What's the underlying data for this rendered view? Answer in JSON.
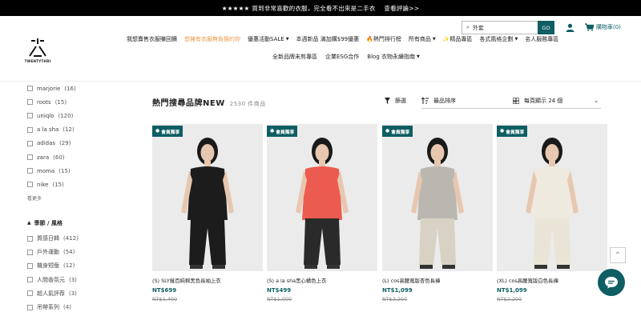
{
  "announcement": {
    "stars": "★★★★★",
    "text": "買到非常喜歡的衣服，完全看不出來是二手衣",
    "link": "查看評論>>"
  },
  "header": {
    "logo_text": "TWENTYTHRI",
    "search": {
      "value": "外套",
      "button": "GO"
    },
    "cart_label": "購物車(0)",
    "nav_row1": [
      {
        "label": "我想賣售衣服賺回饋",
        "chevron": false,
        "highlight": false
      },
      {
        "label": "想擁有衣服無負擔的你",
        "chevron": false,
        "highlight": true
      },
      {
        "label": "優惠活動SALE",
        "chevron": true,
        "highlight": false
      },
      {
        "label": "本週新品 滿加購$99優惠",
        "chevron": false,
        "highlight": false
      },
      {
        "label": "🔥熱門排行榜",
        "chevron": false,
        "highlight": false
      },
      {
        "label": "所有商品",
        "chevron": true,
        "highlight": false
      },
      {
        "label": "✨精品專區",
        "chevron": false,
        "highlight": false
      },
      {
        "label": "各式風格企劃",
        "chevron": true,
        "highlight": false
      },
      {
        "label": "名人服務專區",
        "chevron": false,
        "highlight": false
      }
    ],
    "nav_row2": [
      {
        "label": "全新品牌未剪專區",
        "chevron": false
      },
      {
        "label": "企業ESG合作",
        "chevron": false
      },
      {
        "label": "Blog 衣物永續指南",
        "chevron": true
      }
    ]
  },
  "sidebar": {
    "brands": [
      {
        "name": "marjorie",
        "count": "(16)"
      },
      {
        "name": "roots",
        "count": "(15)"
      },
      {
        "name": "uniqlo",
        "count": "(120)"
      },
      {
        "name": "a la sha",
        "count": "(12)"
      },
      {
        "name": "adidas",
        "count": "(29)"
      },
      {
        "name": "zara",
        "count": "(60)"
      },
      {
        "name": "moma",
        "count": "(15)"
      },
      {
        "name": "nike",
        "count": "(15)"
      }
    ],
    "more_label": "看更多",
    "season_title": "季節 / 風格",
    "seasons": [
      {
        "name": "質感日韓",
        "count": "(412)"
      },
      {
        "name": "戶外運動",
        "count": "(54)"
      },
      {
        "name": "機身短版",
        "count": "(12)"
      },
      {
        "name": "人間香氛元",
        "count": "(3)"
      },
      {
        "name": "超人氣評荐",
        "count": "(3)"
      },
      {
        "name": "吊帶系列",
        "count": "(4)"
      }
    ]
  },
  "main": {
    "title": "熱門搜尋品牌NEW",
    "count": "2530 件商品",
    "filter_label": "篩選",
    "sort_label": "最品排序",
    "per_page_label": "每頁顯示 24 個",
    "products": [
      {
        "badge": "會員獨享",
        "title": "(S) SLY幾百純棉黑色長袖上衣",
        "price": "NT$699",
        "orig_price": "NT$1,400",
        "top_color": "#1c1c1c",
        "bottom_color": "#1c1c1c"
      },
      {
        "badge": "會員獨享",
        "title": "(S) a la sha黑心橘色上衣",
        "price": "NT$499",
        "orig_price": "NT$1,000",
        "top_color": "#ec5b4f",
        "bottom_color": "#2a2a2a"
      },
      {
        "badge": "會員獨享",
        "title": "(L) cos高腰寬版杏色長褲",
        "price": "NT$1,099",
        "orig_price": "NT$2,200",
        "top_color": "#b9b7b0",
        "bottom_color": "#d8d2c4"
      },
      {
        "badge": "會員獨享",
        "title": "(XL) cos高腰寬版白色長褲",
        "price": "NT$1,099",
        "orig_price": "NT$2,200",
        "top_color": "#efeadf",
        "bottom_color": "#eae4d6"
      }
    ]
  }
}
